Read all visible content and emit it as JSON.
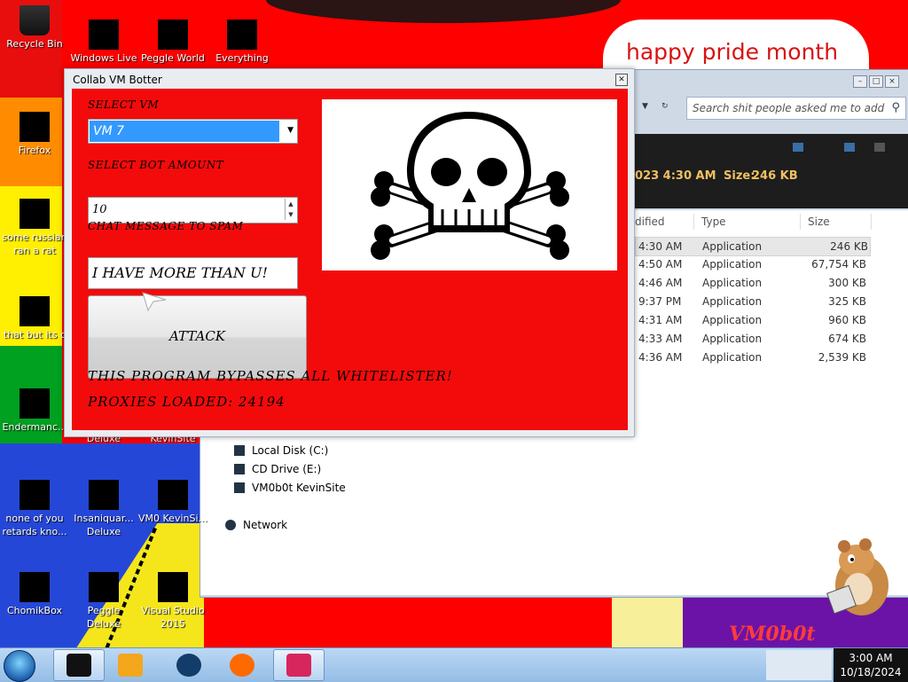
{
  "wallpaper": {
    "bubble_text": "happy pride month",
    "brand_text": "VM0b0t"
  },
  "desktop_icons": [
    {
      "label": "Recycle Bin"
    },
    {
      "label": "Windows Live"
    },
    {
      "label": "Peggle World"
    },
    {
      "label": "Everything"
    },
    {
      "label": "Firefox"
    },
    {
      "label": "some russian ran a rat"
    },
    {
      "label": "that but its c"
    },
    {
      "label": "Endermanc..."
    },
    {
      "label": "Deluxe"
    },
    {
      "label": "KevinSite"
    },
    {
      "label": "none of you retards kno..."
    },
    {
      "label": "Insaniquar... Deluxe"
    },
    {
      "label": "VM0 KevinSi..."
    },
    {
      "label": "ChomikBox"
    },
    {
      "label": "Peggle Deluxe"
    },
    {
      "label": "Visual Studio 2015"
    }
  ],
  "explorer": {
    "search_placeholder": "Search shit people asked me to add",
    "details_date": "023 4:30 AM",
    "details_size_label": "Size:",
    "details_size_value": "246 KB",
    "columns": [
      "dified",
      "Type",
      "Size"
    ],
    "rows": [
      {
        "modified": "4:30 AM",
        "type": "Application",
        "size": "246 KB"
      },
      {
        "modified": "4:50 AM",
        "type": "Application",
        "size": "67,754 KB"
      },
      {
        "modified": "4:46 AM",
        "type": "Application",
        "size": "300 KB"
      },
      {
        "modified": "9:37 PM",
        "type": "Application",
        "size": "325 KB"
      },
      {
        "modified": "4:31 AM",
        "type": "Application",
        "size": "960 KB"
      },
      {
        "modified": "4:33 AM",
        "type": "Application",
        "size": "674 KB"
      },
      {
        "modified": "4:36 AM",
        "type": "Application",
        "size": "2,539 KB"
      }
    ],
    "tree": [
      "Local Disk (C:)",
      "CD Drive (E:)",
      "VM0b0t KevinSite",
      "Network"
    ]
  },
  "botwin": {
    "title": "Collab VM Botter",
    "close_glyph": "✕",
    "select_vm_label": "SELECT VM",
    "select_vm_value": "VM 7",
    "bot_amount_label": "SELECT BOT AMOUNT",
    "bot_amount_value": "10",
    "chat_label": "CHAT MESSAGE TO SPAM",
    "chat_value": "I HAVE MORE THAN U!",
    "attack_label": "ATTACK",
    "bypass_text": "THIS PROGRAM BYPASSES ALL WHITELISTER!",
    "proxies_text": "PROXIES LOADED: 24194"
  },
  "taskbar": {
    "time": "3:00 AM",
    "date": "10/18/2024"
  },
  "colors": {
    "bot_bg": "#f30b0b",
    "wallpaper_red": "#ff0000",
    "accent_blue": "#3399ff"
  }
}
